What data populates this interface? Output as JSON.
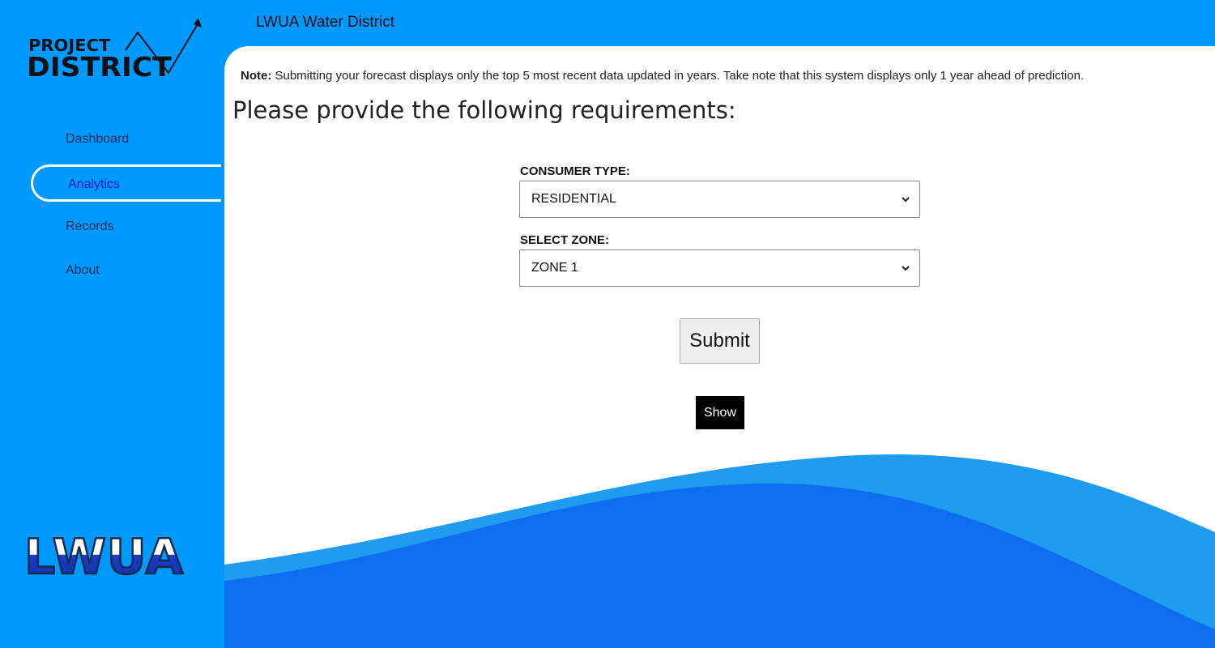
{
  "app": {
    "header_title": "LWUA Water District",
    "logo_top_line": "PROJECT",
    "logo_bottom_line": "DISTRICT",
    "logo_bottom_text": "LWUA"
  },
  "sidebar": {
    "items": [
      {
        "label": "Dashboard",
        "active": false
      },
      {
        "label": "Analytics",
        "active": true
      },
      {
        "label": "Records",
        "active": false
      },
      {
        "label": "About",
        "active": false
      }
    ]
  },
  "main": {
    "note_label": "Note:",
    "note_text": " Submitting your forecast displays only the top 5 most recent data updated in years. Take note that this system displays only 1 year ahead of prediction.",
    "title": "Please provide the following requirements:",
    "consumer_type": {
      "label": "CONSUMER TYPE:",
      "value": "RESIDENTIAL"
    },
    "zone": {
      "label": "SELECT ZONE:",
      "value": "ZONE 1"
    },
    "submit_label": "Submit",
    "show_label": "Show"
  },
  "colors": {
    "sidebar_bg": "#0099ff",
    "panel_bg": "#ffffff",
    "wave_light": "#1f9cf0",
    "wave_dark": "#0e6ef0",
    "active_border": "#ffffff"
  }
}
